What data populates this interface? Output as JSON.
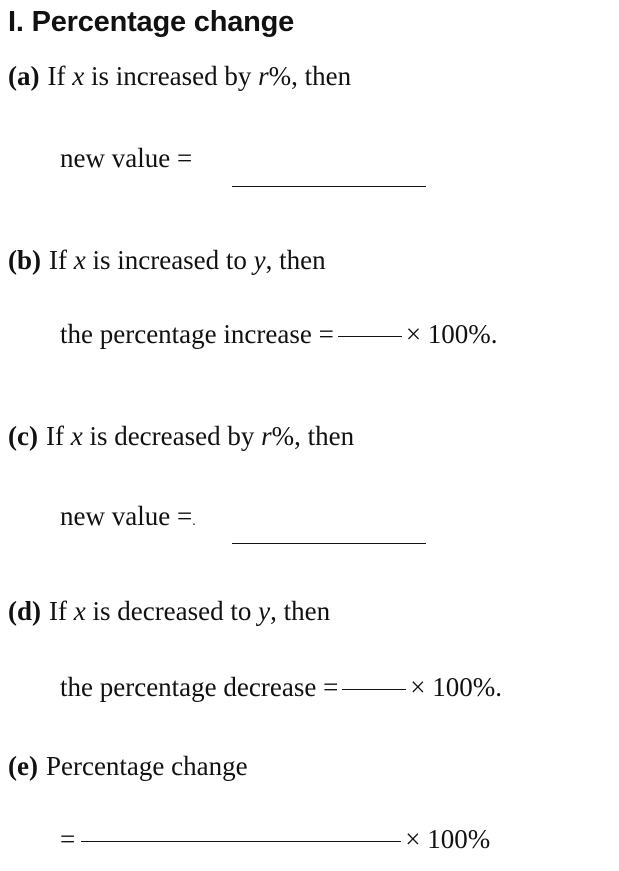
{
  "title": "I. Percentage change",
  "items": {
    "a": {
      "label": "(a)",
      "if": "If",
      "var_x": "x",
      "text": "is increased by",
      "var_r": "r",
      "suffix": "%, then",
      "sub": "new value ="
    },
    "b": {
      "label": "(b)",
      "if": "If",
      "var_x": "x",
      "text": "is increased to",
      "var_y": "y",
      "suffix": ", then",
      "sub": "the percentage increase =",
      "times": "× 100%."
    },
    "c": {
      "label": "(c)",
      "if": "If",
      "var_x": "x",
      "text": "is decreased by",
      "var_r": "r",
      "suffix": "%, then",
      "sub": "new value =",
      "dot": "."
    },
    "d": {
      "label": "(d)",
      "if": "If",
      "var_x": "x",
      "text": "is decreased to",
      "var_y": "y",
      "suffix": ", then",
      "sub": "the percentage decrease =",
      "times": "× 100%."
    },
    "e": {
      "label": "(e)",
      "text": "Percentage change",
      "sub": "=",
      "times": "× 100%"
    }
  }
}
